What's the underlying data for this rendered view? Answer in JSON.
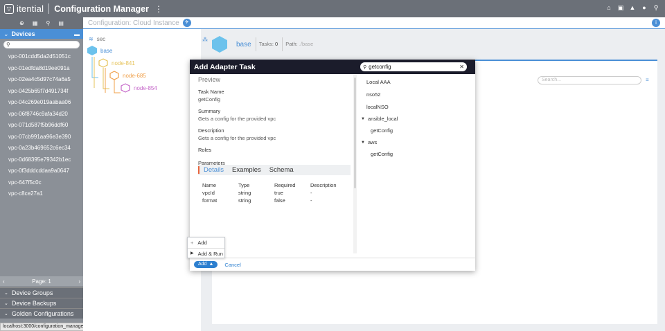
{
  "app": {
    "brand": "itential",
    "title": "Configuration Manager",
    "menu_icon": "kebab-icon"
  },
  "topbar_icons": [
    "home-icon",
    "briefcase-icon",
    "bell-icon",
    "user-icon",
    "search-icon"
  ],
  "sidebar": {
    "toolbar_icons": [
      "add-icon",
      "grid-icon",
      "search-icon",
      "document-icon"
    ],
    "devices_label": "Devices",
    "devices": [
      "vpc-001cdd5da2d51051c",
      "vpc-01edfda8d19ee091a",
      "vpc-02ea4c5d97c74a6a5",
      "vpc-0425b65f7d491734f",
      "vpc-04c269e019aabaa06",
      "vpc-06f8746c9afa34d20",
      "vpc-071d587f5b96ddf60",
      "vpc-07cb991aa96e3e390",
      "vpc-0a23b469652c6ec34",
      "vpc-0d68395e79342b1ec",
      "vpc-0f3dddcddaa9a0647",
      "vpc-647f5c0c",
      "vpc-c8ce27a1"
    ],
    "pager": "Page: 1",
    "sections": [
      "Device Groups",
      "Device Backups",
      "Golden Configurations"
    ]
  },
  "status_url": "localhost:3000/configuration_manager/#",
  "breadcrumb": "Configuration: Cloud Instance",
  "tree": {
    "root": "sec",
    "nodes": [
      {
        "label": "base",
        "color": "#6cc2ec"
      },
      {
        "label": "node-841",
        "color": "#e6c35a"
      },
      {
        "label": "node-685",
        "color": "#f0a04a"
      },
      {
        "label": "node-854",
        "color": "#c567c9"
      }
    ]
  },
  "base_header": {
    "name": "base",
    "tasks_label": "Tasks:",
    "tasks_value": "0",
    "path_label": "Path:",
    "path_value": "./base"
  },
  "content_search_placeholder": "Search...",
  "modal": {
    "title": "Add Adapter Task",
    "search_value": "getconfig",
    "preview_title": "Preview",
    "task_name_label": "Task Name",
    "task_name": "getConfig",
    "summary_label": "Summary",
    "summary": "Gets a config for the provided vpc",
    "description_label": "Description",
    "description": "Gets a config for the provided vpc",
    "roles_label": "Roles",
    "parameters_label": "Parameters",
    "tabs": [
      "Details",
      "Examples",
      "Schema"
    ],
    "param_headers": [
      "Name",
      "Type",
      "Required",
      "Description"
    ],
    "params": [
      [
        "vpcId",
        "string",
        "true",
        "-"
      ],
      [
        "format",
        "string",
        "false",
        "-"
      ]
    ],
    "results": {
      "items": [
        "Local AAA",
        "nso52",
        "localNSO"
      ],
      "groups": [
        {
          "name": "ansible_local",
          "children": [
            "getConfig"
          ]
        },
        {
          "name": "aws",
          "children": [
            "getConfig"
          ]
        }
      ]
    },
    "add_label": "Add",
    "cancel_label": "Cancel",
    "dropdown": [
      "Add",
      "Add & Run"
    ]
  }
}
